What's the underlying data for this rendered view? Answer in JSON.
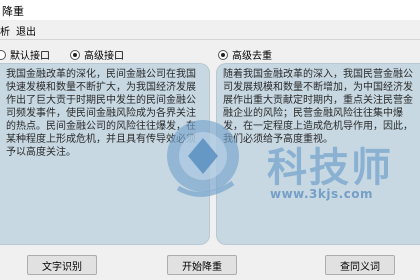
{
  "window": {
    "title": "降重"
  },
  "menu": {
    "items": [
      "析",
      "退出"
    ]
  },
  "options": {
    "default_interface": "默认接口",
    "advanced_interface": "高级接口",
    "advanced_dedup": "高级去重"
  },
  "left_panel": {
    "text": "我国金融改革的深化，民间金融公司在我国快速发模和数量不断扩大，为我国经济发展作出了巨大贡于时期民中发生的民间金融公司频发事件，使民间金融风险成为各界关注的热点。民间金融公司的风险往往爆发，在某种程度上形成危机，并且具有传导效必须予以高度关注。"
  },
  "right_panel": {
    "text": "随着我国金融改革的深入，我国民营金融公司发展规模和数量不断增加，为中国经济发展作出重大贡献定时期内，重点关注民营金融企业的风险；民营金融风险往往集中爆发，在一定程度上造成危机导作用，因此，我们必须给予高度重视。"
  },
  "buttons": {
    "ocr": "文字识别",
    "start": "开始降重",
    "synonym": "查同义词"
  },
  "watermark": {
    "brand": "科技师",
    "url": "www.3kjs.com"
  }
}
